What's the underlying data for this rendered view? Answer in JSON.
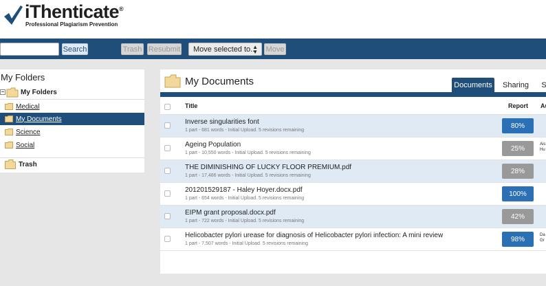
{
  "brand": {
    "name": "iThenticate",
    "registered": "®",
    "tagline": "Professional Plagiarism Prevention"
  },
  "toolbar": {
    "search_value": "",
    "search_label": "Search",
    "trash_label": "Trash",
    "resubmit_label": "Resubmit",
    "move_select_label": "Move selected to...",
    "move_label": "Move"
  },
  "sidebar": {
    "title": "My Folders",
    "root_label": "My Folders",
    "items": [
      {
        "label": "Medical"
      },
      {
        "label": "My Documents",
        "active": true
      },
      {
        "label": "Science"
      },
      {
        "label": "Social"
      }
    ],
    "trash_label": "Trash"
  },
  "main": {
    "title": "My Documents",
    "tabs": [
      {
        "label": "Documents",
        "active": true
      },
      {
        "label": "Sharing"
      },
      {
        "label": "S"
      }
    ],
    "columns": {
      "title": "Title",
      "report": "Report",
      "author": "Au"
    },
    "documents": [
      {
        "title": "Inverse singularities font",
        "meta": "1 part - 681 words - Initial Upload. 5 revisions remaining",
        "report": "80%",
        "report_color": "blue",
        "author": ""
      },
      {
        "title": "Ageing Population",
        "meta": "1 part - 10,550 words - Initial Upload. 5 revisions remaining",
        "report": "25%",
        "report_color": "gray",
        "author": "Ais Hu"
      },
      {
        "title": "THE DIMINISHING OF LUCKY FLOOR PREMIUM.pdf",
        "meta": "1 part - 17,486 words - Initial Upload. 5 revisions remaining",
        "report": "28%",
        "report_color": "gray",
        "author": ""
      },
      {
        "title": "201201529187 - Haley Hoyer.docx.pdf",
        "meta": "1 part - 654 words - Initial Upload. 5 revisions remaining",
        "report": "100%",
        "report_color": "blue",
        "author": ""
      },
      {
        "title": "EIPM grant proposal.docx.pdf",
        "meta": "1 part - 722 words - Initial Upload. 5 revisions remaining",
        "report": "42%",
        "report_color": "gray",
        "author": ""
      },
      {
        "title": "Helicobacter pylori urease for diagnosis of Helicobacter pylori infection: A mini review",
        "meta": "1 part - 7,507 words - Initial Upload. 5 revisions remaining",
        "report": "98%",
        "report_color": "blue",
        "author": "Da Gr"
      }
    ]
  },
  "colors": {
    "navy": "#1e4e79",
    "report_blue": "#2b6fb5",
    "report_gray": "#999999",
    "row_alt": "#dfeaf5"
  }
}
